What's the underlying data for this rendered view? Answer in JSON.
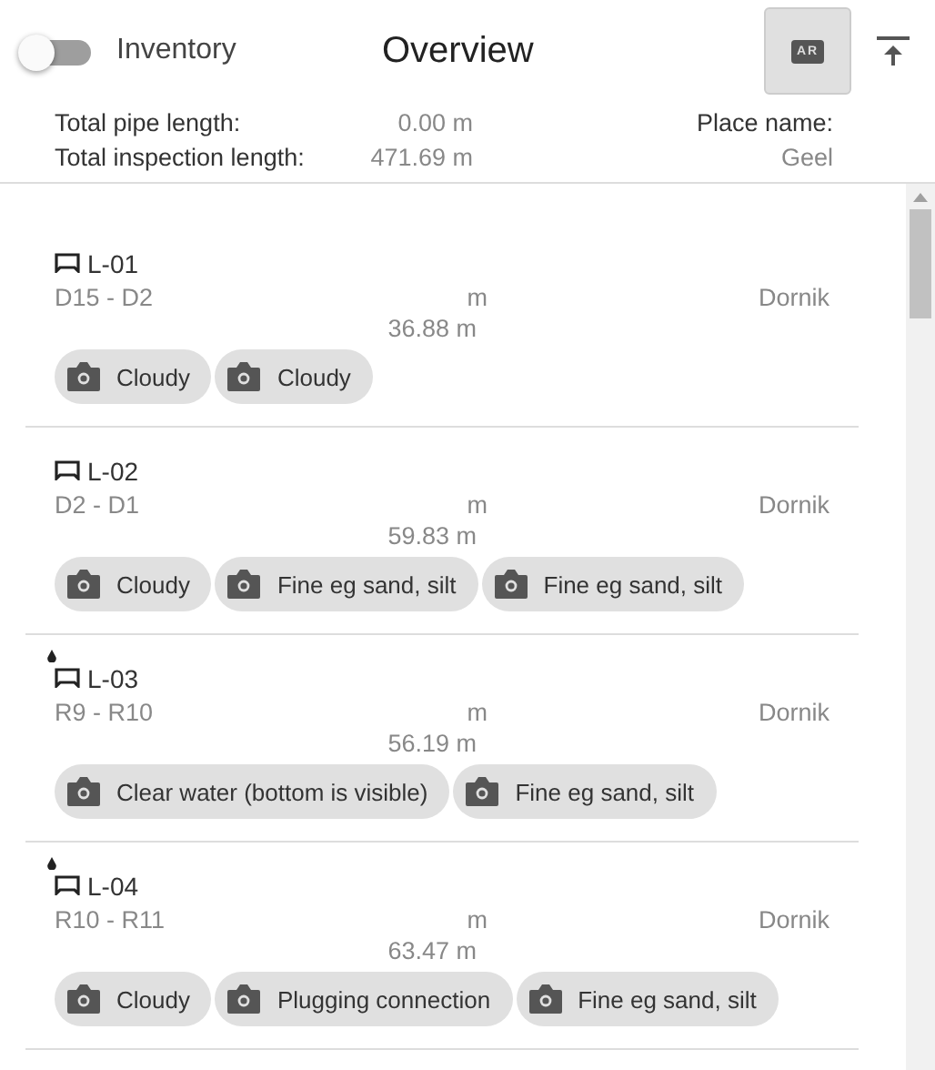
{
  "header": {
    "toggle": {
      "label": "Inventory",
      "on": false
    },
    "title": "Overview",
    "ar_button": {
      "label": "AR",
      "selected": true
    }
  },
  "stats": {
    "pipe_label": "Total pipe length:",
    "pipe_value": "0.00 m",
    "inspection_label": "Total inspection length:",
    "inspection_value": "471.69 m",
    "place_label": "Place name:",
    "place_value": "Geel"
  },
  "items": [
    {
      "name": "L-01",
      "drop": false,
      "route": "D15 - D2",
      "unit": "m",
      "length": "36.88 m",
      "place": "Dornik",
      "chips": [
        "Cloudy",
        "Cloudy"
      ]
    },
    {
      "name": "L-02",
      "drop": false,
      "route": "D2 - D1",
      "unit": "m",
      "length": "59.83 m",
      "place": "Dornik",
      "chips": [
        "Cloudy",
        "Fine eg sand, silt",
        "Fine eg sand, silt"
      ]
    },
    {
      "name": "L-03",
      "drop": true,
      "route": "R9 - R10",
      "unit": "m",
      "length": "56.19 m",
      "place": "Dornik",
      "chips": [
        "Clear water (bottom is visible)",
        "Fine eg sand, silt"
      ]
    },
    {
      "name": "L-04",
      "drop": true,
      "route": "R10 - R11",
      "unit": "m",
      "length": "63.47 m",
      "place": "Dornik",
      "chips": [
        "Cloudy",
        "Plugging connection",
        "Fine eg sand, silt"
      ]
    }
  ]
}
